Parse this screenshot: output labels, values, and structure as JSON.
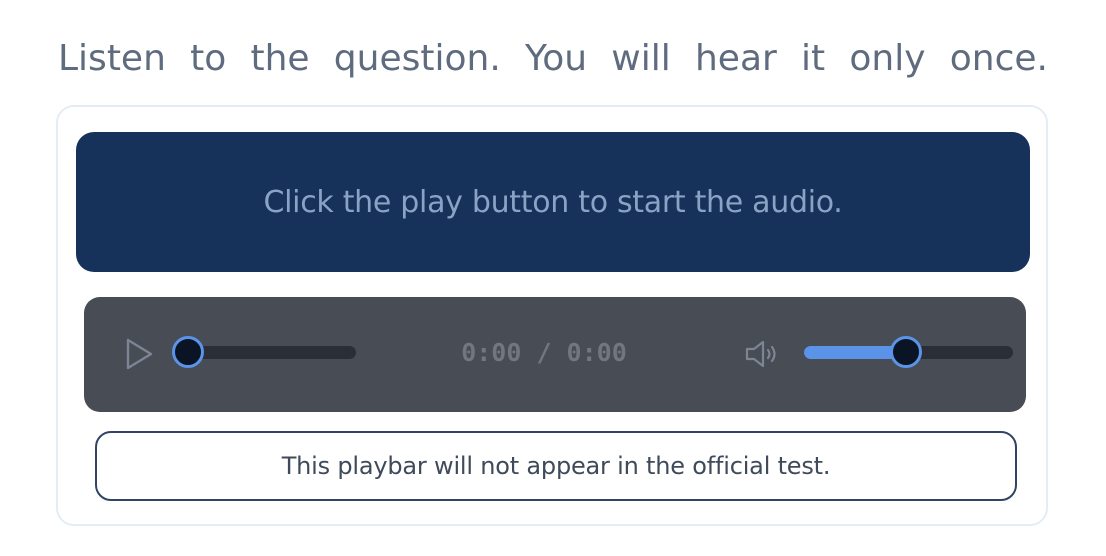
{
  "instruction": "Listen to the question. You will hear it only once.",
  "prompt_box": {
    "text": "Click the play button to start the audio."
  },
  "player": {
    "play_icon": "play-icon",
    "time_display": "0:00 / 0:00",
    "seek_progress": 0,
    "volume_icon": "volume-icon",
    "volume_level": 0.49,
    "accent_color": "#5b93e8",
    "background_color": "#474c55"
  },
  "notice": {
    "text": "This playbar will not appear in the official test."
  },
  "colors": {
    "prompt_background": "#16315a",
    "instruction_text": "#5f6b7e",
    "notice_border": "#314463"
  }
}
